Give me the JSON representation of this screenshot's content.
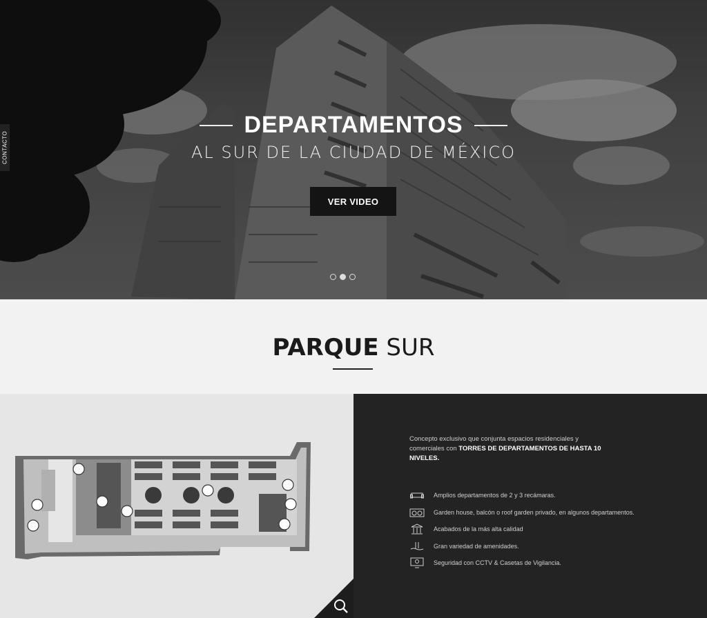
{
  "sidebar": {
    "contact_tab": "CONTACTO"
  },
  "hero": {
    "title": "DEPARTAMENTOS",
    "subtitle": "AL SUR DE LA CIUDAD DE MÉXICO",
    "cta_label": "VER VIDEO",
    "slides": 3,
    "active_slide": 1
  },
  "section": {
    "title_bold": "PARQUE",
    "title_light": "SUR"
  },
  "info": {
    "intro_text": "Concepto exclusivo que conjunta espacios residenciales y comerciales con ",
    "intro_strong": "TORRES DE DEPARTAMENTOS DE HASTA 10 NIVELES.",
    "features": [
      {
        "icon": "sofa-icon",
        "label": "Amplios departamentos de 2 y 3 recámaras."
      },
      {
        "icon": "garden-icon",
        "label": "Garden house, balcón o roof garden privado, en algunos departamentos."
      },
      {
        "icon": "columns-icon",
        "label": "Acabados de la más alta calidad"
      },
      {
        "icon": "pool-icon",
        "label": "Gran variedad de amenidades."
      },
      {
        "icon": "cctv-icon",
        "label": "Seguridad con CCTV & Casetas de Vigilancia."
      }
    ]
  },
  "colors": {
    "dark_panel": "#232323",
    "button": "#141414",
    "band": "#f2f2f2"
  }
}
